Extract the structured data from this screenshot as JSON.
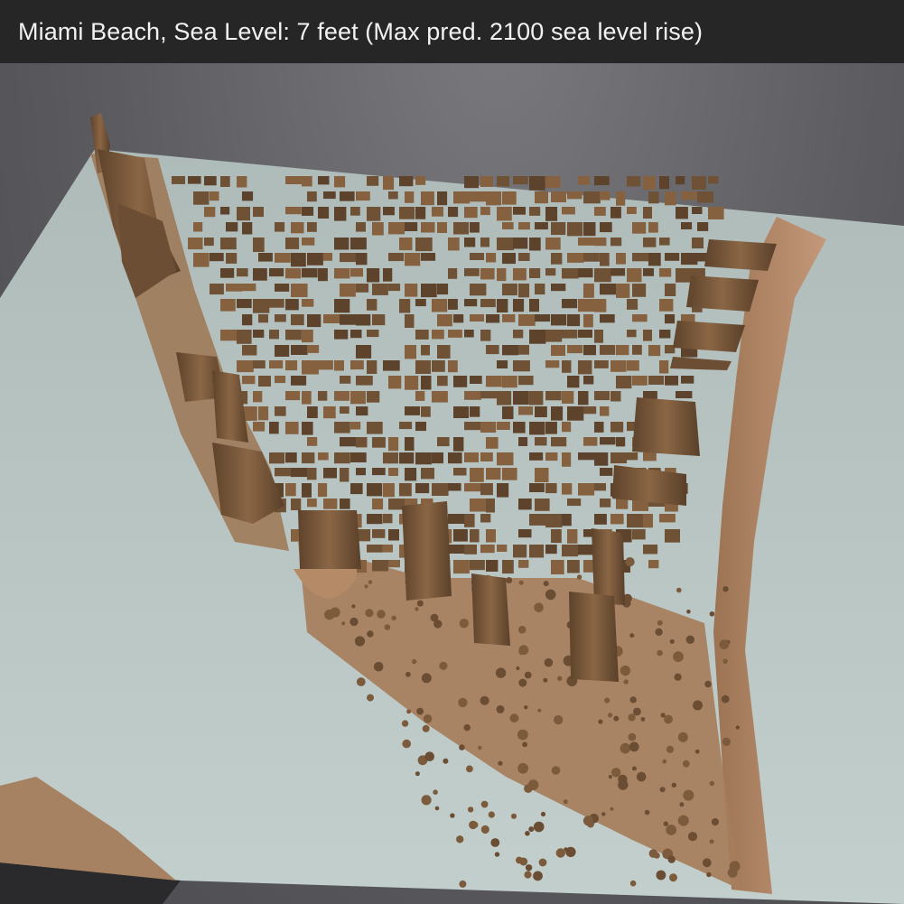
{
  "header": {
    "title": "Miami Beach, Sea Level: 7 feet (Max pred. 2100 sea level rise)"
  },
  "colors": {
    "title_bar": "#262626",
    "title_text": "#f2f2f2",
    "background": "#5c5c60",
    "water": "#b9c6c4",
    "land": "#a57c58",
    "building": "#6f5236",
    "building_light": "#8a6645",
    "beach": "#c19572"
  },
  "map": {
    "sea_level_feet": 7,
    "view": "3d-terrain-model"
  }
}
